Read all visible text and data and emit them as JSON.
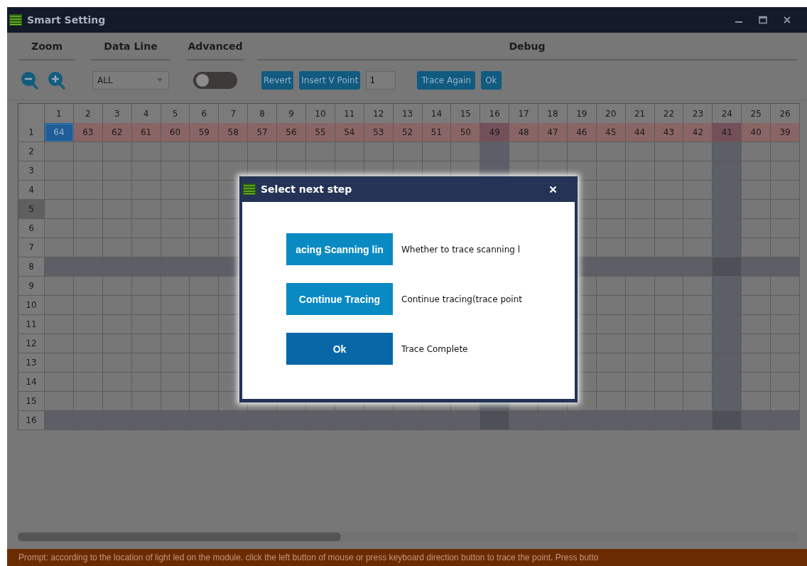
{
  "window": {
    "title": "Smart Setting"
  },
  "toolbar": {
    "sections": [
      {
        "kind": "zoom",
        "title": "Zoom"
      },
      {
        "kind": "dataline",
        "title": "Data Line",
        "value": "ALL"
      },
      {
        "kind": "advanced",
        "title": "Advanced",
        "on": false
      },
      {
        "kind": "debug",
        "title": "Debug",
        "buttons": [
          "Revert",
          "Insert V Point"
        ],
        "point_value": "1",
        "more_buttons": [
          "Trace Again",
          "Ok"
        ]
      }
    ]
  },
  "grid": {
    "columns": [
      {
        "label": "1",
        "highlighted": false
      },
      {
        "label": "2",
        "highlighted": false
      },
      {
        "label": "3",
        "highlighted": false
      },
      {
        "label": "4",
        "highlighted": false
      },
      {
        "label": "5",
        "highlighted": false
      },
      {
        "label": "6",
        "highlighted": false
      },
      {
        "label": "7",
        "highlighted": false
      },
      {
        "label": "8",
        "highlighted": false
      },
      {
        "label": "9",
        "highlighted": false
      },
      {
        "label": "10",
        "highlighted": false
      },
      {
        "label": "11",
        "highlighted": false
      },
      {
        "label": "12",
        "highlighted": false
      },
      {
        "label": "13",
        "highlighted": false
      },
      {
        "label": "14",
        "highlighted": false
      },
      {
        "label": "15",
        "highlighted": false
      },
      {
        "label": "16",
        "highlighted": true
      },
      {
        "label": "17",
        "highlighted": false
      },
      {
        "label": "18",
        "highlighted": false
      },
      {
        "label": "19",
        "highlighted": false
      },
      {
        "label": "20",
        "highlighted": false
      },
      {
        "label": "21",
        "highlighted": false
      },
      {
        "label": "22",
        "highlighted": false
      },
      {
        "label": "23",
        "highlighted": false
      },
      {
        "label": "24",
        "highlighted": true
      },
      {
        "label": "25",
        "highlighted": false
      },
      {
        "label": "26",
        "highlighted": false
      }
    ],
    "rows": [
      {
        "label": "1",
        "selected": false,
        "highlighted": false,
        "traced": true,
        "cells": [
          {
            "value": "64",
            "selected": true
          },
          {
            "value": "63",
            "selected": false
          },
          {
            "value": "62",
            "selected": false
          },
          {
            "value": "61",
            "selected": false
          },
          {
            "value": "60",
            "selected": false
          },
          {
            "value": "59",
            "selected": false
          },
          {
            "value": "58",
            "selected": false
          },
          {
            "value": "57",
            "selected": false
          },
          {
            "value": "56",
            "selected": false
          },
          {
            "value": "55",
            "selected": false
          },
          {
            "value": "54",
            "selected": false
          },
          {
            "value": "53",
            "selected": false
          },
          {
            "value": "52",
            "selected": false
          },
          {
            "value": "51",
            "selected": false
          },
          {
            "value": "50",
            "selected": false
          },
          {
            "value": "49",
            "selected": false
          },
          {
            "value": "48",
            "selected": false
          },
          {
            "value": "47",
            "selected": false
          },
          {
            "value": "46",
            "selected": false
          },
          {
            "value": "45",
            "selected": false
          },
          {
            "value": "44",
            "selected": false
          },
          {
            "value": "43",
            "selected": false
          },
          {
            "value": "42",
            "selected": false
          },
          {
            "value": "41",
            "selected": false
          },
          {
            "value": "40",
            "selected": false
          },
          {
            "value": "39",
            "selected": false
          }
        ]
      },
      {
        "label": "2",
        "selected": false,
        "highlighted": false,
        "traced": false
      },
      {
        "label": "3",
        "selected": false,
        "highlighted": false,
        "traced": false
      },
      {
        "label": "4",
        "selected": false,
        "highlighted": false,
        "traced": false
      },
      {
        "label": "5",
        "selected": true,
        "highlighted": false,
        "traced": false
      },
      {
        "label": "6",
        "selected": false,
        "highlighted": false,
        "traced": false
      },
      {
        "label": "7",
        "selected": false,
        "highlighted": false,
        "traced": false
      },
      {
        "label": "8",
        "selected": false,
        "highlighted": true,
        "traced": false
      },
      {
        "label": "9",
        "selected": false,
        "highlighted": false,
        "traced": false
      },
      {
        "label": "10",
        "selected": false,
        "highlighted": false,
        "traced": false
      },
      {
        "label": "11",
        "selected": false,
        "highlighted": false,
        "traced": false
      },
      {
        "label": "12",
        "selected": false,
        "highlighted": false,
        "traced": false
      },
      {
        "label": "13",
        "selected": false,
        "highlighted": false,
        "traced": false
      },
      {
        "label": "14",
        "selected": false,
        "highlighted": false,
        "traced": false
      },
      {
        "label": "15",
        "selected": false,
        "highlighted": false,
        "traced": false
      },
      {
        "label": "16",
        "selected": false,
        "highlighted": true,
        "traced": false
      }
    ]
  },
  "status_bar": {
    "text": "Prompt: according to the location of light led on the module. click the left button of mouse or press keyboard direction button to trace the point. Press butto"
  },
  "dialog": {
    "title": "Select next step",
    "options": [
      {
        "kind": "primary",
        "button": "acing Scanning lin",
        "description": "Whether to trace scanning l"
      },
      {
        "kind": "primary",
        "button": "Continue Tracing",
        "description": "Continue tracing(trace point"
      },
      {
        "kind": "confirm",
        "button": "Ok",
        "description": "Trace Complete"
      }
    ]
  }
}
